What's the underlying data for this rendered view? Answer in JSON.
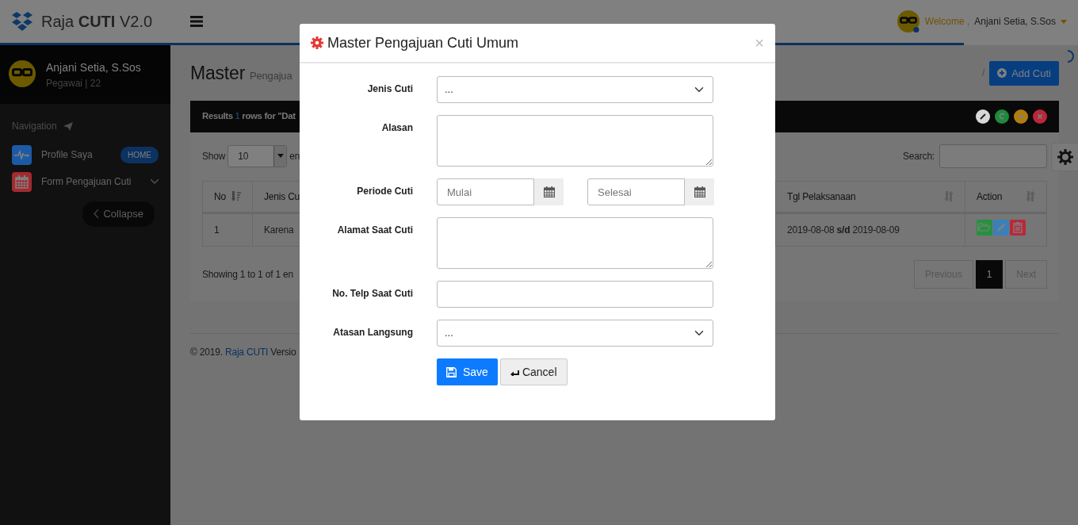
{
  "header": {
    "brand_prefix": "Raja",
    "brand_bold": "CUTI",
    "brand_suffix": "V2.0",
    "welcome": "Welcome ,",
    "user": "Anjani Setia, S.Sos"
  },
  "loading_bar": {
    "level": 0.894
  },
  "sidebar": {
    "user_name": "Anjani Setia, S.Sos",
    "user_role": "Pegawai | 22",
    "nav_heading": "Navigation",
    "items": [
      {
        "label": "Profile Saya",
        "kind": "pulse",
        "color": "#1d5aa6",
        "badge": "HOME"
      },
      {
        "label": "Form Pengajuan Cuti",
        "kind": "calendar",
        "color": "#a32a2e",
        "expanded": false
      }
    ],
    "collapse": "Collapse"
  },
  "page": {
    "title": "Master",
    "subtitle": "Pengajua",
    "breadcrumb_separator": "/",
    "add_button": "Add Cuti"
  },
  "panel": {
    "results_label": "Results",
    "results_count": "1",
    "results_rest": "rows for \"Dat",
    "tools": [
      {
        "kind": "expand",
        "color": "#d8d8d8"
      },
      {
        "kind": "reload",
        "color": "#1f8a3c"
      },
      {
        "kind": "minimize",
        "color": "#b07d10"
      },
      {
        "kind": "close",
        "color": "#b8283a"
      }
    ],
    "show_label": "Show",
    "page_size": "10",
    "entries_label": "en",
    "search_label": "Search:",
    "columns": [
      {
        "label": "No",
        "sorted": true
      },
      {
        "label": "Jenis Cu"
      },
      {
        "label": "Tgl Pelaksanaan",
        "sorted": false
      },
      {
        "label": "Action",
        "sorted": false
      }
    ],
    "rows": [
      {
        "cells": [
          "1",
          "Karena",
          "2019-08-08 **s/d** 2019-08-09"
        ],
        "actions": [
          {
            "kind": "open",
            "color": "#25913f"
          },
          {
            "kind": "edit",
            "color": "#3a80b8"
          },
          {
            "kind": "delete",
            "color": "#b8283a"
          }
        ]
      }
    ],
    "info": "Showing 1 to 1 of 1 en",
    "pagination": {
      "previous": {
        "label": "Previous",
        "disabled": true
      },
      "pages": [
        {
          "label": "1",
          "selected": true
        }
      ],
      "next": {
        "label": "Next",
        "disabled": true
      }
    }
  },
  "footer": {
    "copyright": "© 2019.",
    "link": "Raja CUTI",
    "rest": "Versio"
  },
  "modal": {
    "title": "Master Pengajuan Cuti Umum",
    "close": "×",
    "fields": [
      {
        "label": "Jenis Cuti",
        "kind": "select",
        "value": "..."
      },
      {
        "label": "Alasan",
        "kind": "textarea"
      },
      {
        "label": "Periode Cuti",
        "kind": "daterange",
        "start_placeholder": "Mulai",
        "end_placeholder": "Selesai"
      },
      {
        "label": "Alamat Saat Cuti",
        "kind": "textarea"
      },
      {
        "label": "No. Telp Saat Cuti",
        "kind": "text"
      },
      {
        "label": "Atasan Langsung",
        "kind": "select",
        "value": "..."
      }
    ],
    "buttons": [
      {
        "label": "Save",
        "kind": "primary"
      },
      {
        "label": "Cancel",
        "kind": "secondary"
      }
    ]
  }
}
